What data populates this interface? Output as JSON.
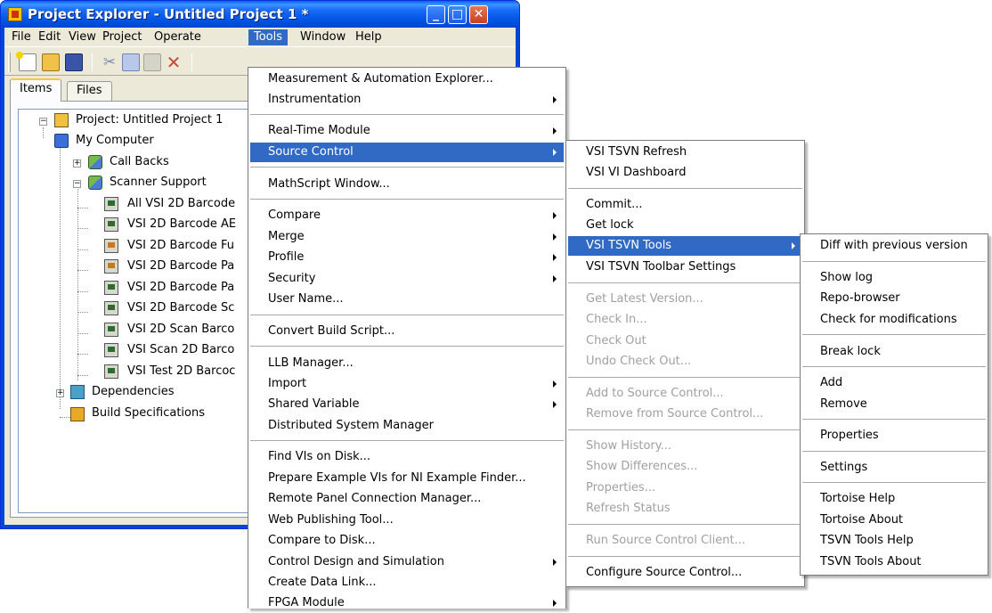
{
  "window": {
    "title": "Project Explorer - Untitled Project 1 *",
    "controls": {
      "minimize": "_",
      "maximize": "□",
      "close": "✕"
    }
  },
  "menubar": [
    "File",
    "Edit",
    "View",
    "Project",
    "Operate",
    "Tools",
    "Window",
    "Help"
  ],
  "toolbar": [
    "new-icon",
    "open-icon",
    "save-all-icon",
    "cut-icon",
    "copy-icon",
    "paste-icon",
    "delete-icon"
  ],
  "tabs": [
    "Items",
    "Files"
  ],
  "tree": [
    "Project: Untitled Project 1",
    "My Computer",
    "Call Backs",
    "Scanner Support",
    "All VSI 2D Barcode",
    "VSI 2D Barcode AE",
    "VSI 2D Barcode Fu",
    "VSI 2D Barcode Pa",
    "VSI 2D Barcode Pa",
    "VSI 2D Barcode Sc",
    "VSI 2D Scan Barco",
    "VSI Scan 2D Barco",
    "VSI Test 2D Barcoc",
    "Dependencies",
    "Build Specifications"
  ],
  "tools_menu": [
    "Measurement & Automation Explorer...",
    "Instrumentation",
    "Real-Time Module",
    "Source Control",
    "MathScript Window...",
    "Compare",
    "Merge",
    "Profile",
    "Security",
    "User Name...",
    "Convert Build Script...",
    "LLB Manager...",
    "Import",
    "Shared Variable",
    "Distributed System Manager",
    "Find VIs on Disk...",
    "Prepare Example VIs for NI Example Finder...",
    "Remote Panel Connection Manager...",
    "Web Publishing Tool...",
    "Compare to Disk...",
    "Control Design and Simulation",
    "Create Data Link...",
    "FPGA Module"
  ],
  "source_control_menu": [
    "VSI TSVN Refresh",
    "VSI VI Dashboard",
    "Commit...",
    "Get lock",
    "VSI TSVN Tools",
    "VSI TSVN Toolbar Settings",
    "Get Latest Version...",
    "Check In...",
    "Check Out",
    "Undo Check Out...",
    "Add to Source Control...",
    "Remove from Source Control...",
    "Show History...",
    "Show Differences...",
    "Properties...",
    "Refresh Status",
    "Run Source Control Client...",
    "Configure Source Control..."
  ],
  "tsvn_tools_menu": [
    "Diff with previous version",
    "Show log",
    "Repo-browser",
    "Check for modifications",
    "Break lock",
    "Add",
    "Remove",
    "Properties",
    "Settings",
    "Tortoise Help",
    "Tortoise About",
    "TSVN Tools Help",
    "TSVN Tools About"
  ],
  "colors": {
    "highlight": "#316ac5",
    "titlebar": "#0053e4",
    "disabled": "#a0a0a0"
  }
}
